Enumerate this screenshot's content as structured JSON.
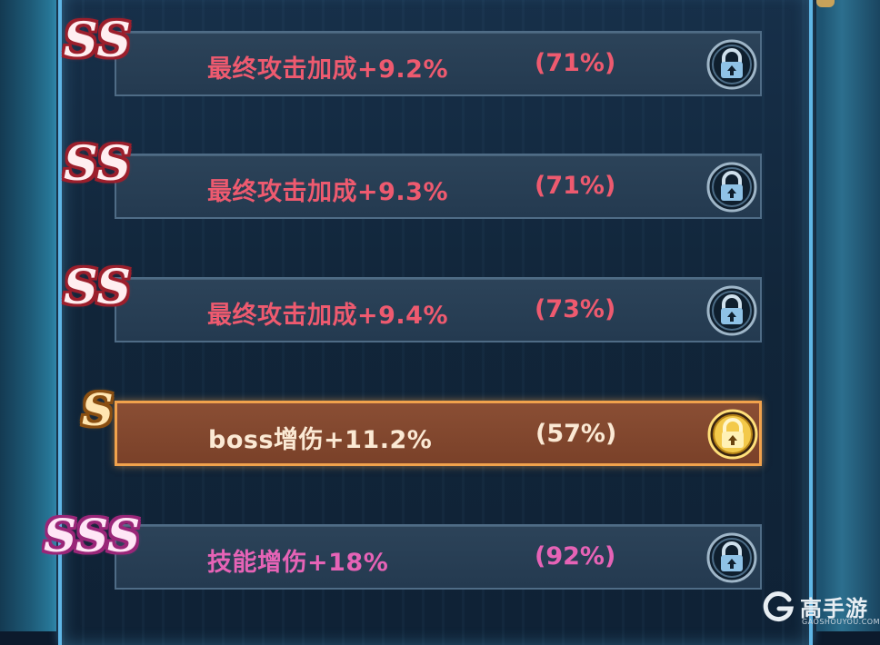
{
  "colors": {
    "normal_text": "#ee5a6f",
    "highlight_text": "#fbe9d4",
    "sss_text": "#e663b6",
    "highlight_border": "#f1a24c",
    "panel_border": "#5fb6e6"
  },
  "rows": [
    {
      "grade": "SS",
      "stat": "最终攻击加成+9.2%",
      "percent": "(71%)",
      "lock_icon": "lock-icon",
      "highlighted": false
    },
    {
      "grade": "SS",
      "stat": "最终攻击加成+9.3%",
      "percent": "(71%)",
      "lock_icon": "lock-icon",
      "highlighted": false
    },
    {
      "grade": "SS",
      "stat": "最终攻击加成+9.4%",
      "percent": "(73%)",
      "lock_icon": "lock-icon",
      "highlighted": false
    },
    {
      "grade": "S",
      "stat": "boss增伤+11.2%",
      "percent": "(57%)",
      "lock_icon": "lock-icon",
      "highlighted": true
    },
    {
      "grade": "SSS",
      "stat": "技能增伤+18%",
      "percent": "(92%)",
      "lock_icon": "lock-icon",
      "highlighted": false
    }
  ],
  "watermark": {
    "name": "高手游",
    "url_text": "GAOSHOUYOU.COM"
  }
}
